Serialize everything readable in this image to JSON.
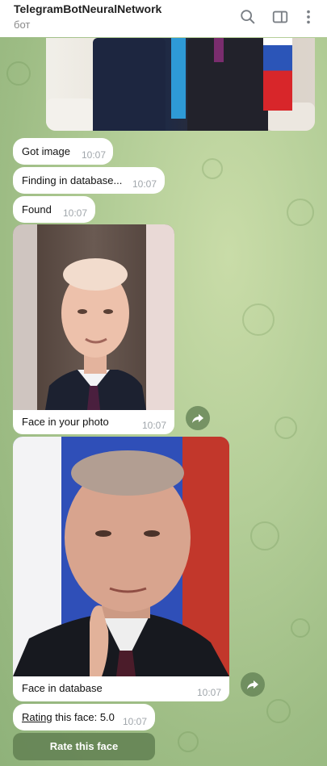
{
  "header": {
    "title": "TelegramBotNeuralNetwork",
    "subtitle": "бот",
    "icons": [
      "search-icon",
      "sidebar-toggle-icon",
      "more-vertical-icon"
    ]
  },
  "messages": [
    {
      "text": "Got image",
      "time": "10:07"
    },
    {
      "text": "Finding in database...",
      "time": "10:07"
    },
    {
      "text": "Found",
      "time": "10:07"
    }
  ],
  "media_messages": [
    {
      "caption": "Face in your photo",
      "time": "10:07"
    },
    {
      "caption": "Face in database",
      "time": "10:07"
    }
  ],
  "rating": {
    "link": "Rating",
    "rest": " this face: 5.0",
    "time": "10:07"
  },
  "button": {
    "label": "Rate this face"
  },
  "colors": {
    "bubble": "#ffffff",
    "time": "#a0a6ab",
    "accent": "#628052"
  }
}
